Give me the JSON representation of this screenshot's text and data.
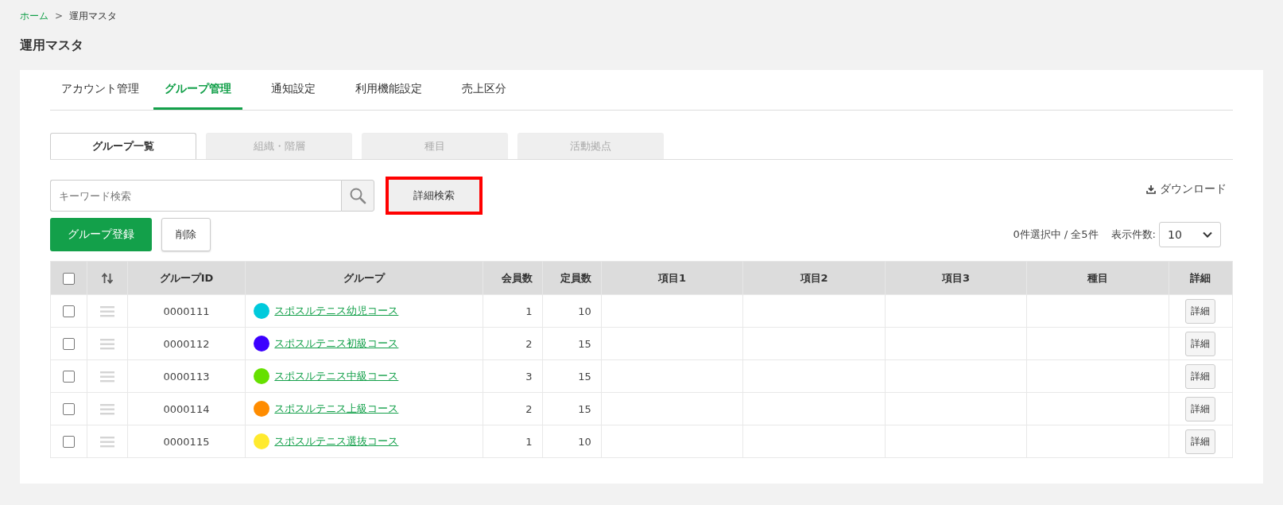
{
  "breadcrumb": [
    {
      "label": "ホーム",
      "link": true
    },
    {
      "label": "運用マスタ",
      "link": false
    }
  ],
  "breadcrumb_separator": ">",
  "page_title": "運用マスタ",
  "tabs": [
    {
      "label": "アカウント管理",
      "selected": false
    },
    {
      "label": "グループ管理",
      "selected": true
    },
    {
      "label": "通知設定",
      "selected": false
    },
    {
      "label": "利用機能設定",
      "selected": false
    },
    {
      "label": "売上区分",
      "selected": false
    }
  ],
  "sub_tabs": [
    {
      "label": "グループ一覧",
      "selected": true
    },
    {
      "label": "組織・階層",
      "selected": false
    },
    {
      "label": "種目",
      "selected": false
    },
    {
      "label": "活動拠点",
      "selected": false
    }
  ],
  "search": {
    "placeholder": "キーワード検索"
  },
  "advanced_search_button": {
    "label": "詳細検索",
    "highlighted": true
  },
  "download_link": "ダウンロード",
  "register_button": "グループ登録",
  "delete_button": "削除",
  "selection_summary": "0件選択中 / 全5件",
  "page_size": {
    "label": "表示件数:",
    "value": "10"
  },
  "table": {
    "columns": [
      "グループID",
      "グループ",
      "会員数",
      "定員数",
      "項目1",
      "項目2",
      "項目3",
      "種目",
      "詳細"
    ],
    "all_checked": false,
    "rows": [
      {
        "checked": false,
        "id": "0000111",
        "color": "#00cadc",
        "group": "スポスルテニス幼児コース",
        "members": "1",
        "capacity": "10",
        "item1": "",
        "item2": "",
        "item3": "",
        "event": "",
        "detail": "詳細"
      },
      {
        "checked": false,
        "id": "0000112",
        "color": "#3c00ff",
        "group": "スポスルテニス初級コース",
        "members": "2",
        "capacity": "15",
        "item1": "",
        "item2": "",
        "item3": "",
        "event": "",
        "detail": "詳細"
      },
      {
        "checked": false,
        "id": "0000113",
        "color": "#66e000",
        "group": "スポスルテニス中級コース",
        "members": "3",
        "capacity": "15",
        "item1": "",
        "item2": "",
        "item3": "",
        "event": "",
        "detail": "詳細"
      },
      {
        "checked": false,
        "id": "0000114",
        "color": "#ff8c00",
        "group": "スポスルテニス上級コース",
        "members": "2",
        "capacity": "15",
        "item1": "",
        "item2": "",
        "item3": "",
        "event": "",
        "detail": "詳細"
      },
      {
        "checked": false,
        "id": "0000115",
        "color": "#ffea2e",
        "group": "スポスルテニス選抜コース",
        "members": "1",
        "capacity": "10",
        "item1": "",
        "item2": "",
        "item3": "",
        "event": "",
        "detail": "詳細"
      }
    ]
  }
}
